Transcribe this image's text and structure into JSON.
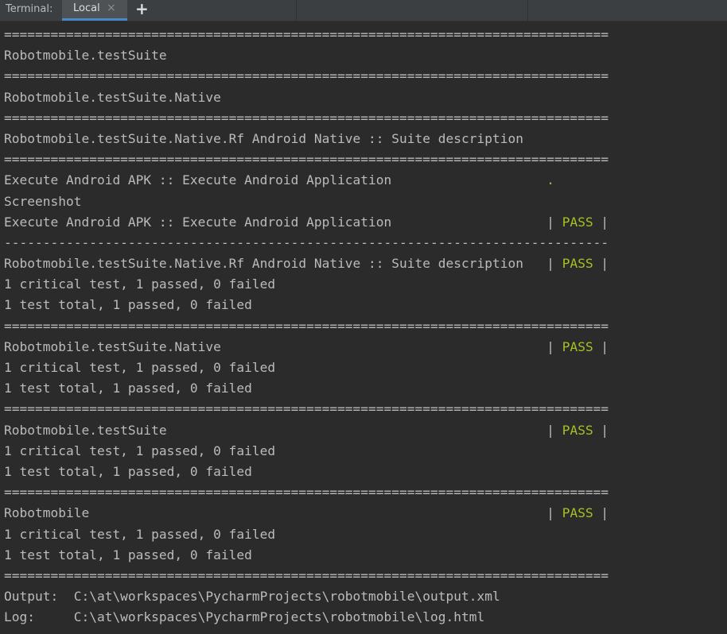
{
  "tabbar": {
    "title": "Terminal:",
    "active_tab": "Local",
    "close_glyph": "×",
    "add_glyph": "+"
  },
  "terminal": {
    "lines": [
      {
        "text": "==============================================================================",
        "pass": "",
        "suffix": ""
      },
      {
        "text": "Robotmobile.testSuite",
        "pass": "",
        "suffix": ""
      },
      {
        "text": "==============================================================================",
        "pass": "",
        "suffix": ""
      },
      {
        "text": "Robotmobile.testSuite.Native",
        "pass": "",
        "suffix": ""
      },
      {
        "text": "==============================================================================",
        "pass": "",
        "suffix": ""
      },
      {
        "text": "Robotmobile.testSuite.Native.Rf Android Native :: Suite description",
        "pass": "",
        "suffix": ""
      },
      {
        "text": "==============================================================================",
        "pass": "",
        "suffix": ""
      },
      {
        "text": "Execute Android APK :: Execute Android Application                    ",
        "pass": ".",
        "suffix": ""
      },
      {
        "text": "Screenshot",
        "pass": "",
        "suffix": ""
      },
      {
        "text": "Execute Android APK :: Execute Android Application                    | ",
        "pass": "PASS",
        "suffix": " |"
      },
      {
        "text": "------------------------------------------------------------------------------",
        "pass": "",
        "suffix": ""
      },
      {
        "text": "Robotmobile.testSuite.Native.Rf Android Native :: Suite description   | ",
        "pass": "PASS",
        "suffix": " |"
      },
      {
        "text": "1 critical test, 1 passed, 0 failed",
        "pass": "",
        "suffix": ""
      },
      {
        "text": "1 test total, 1 passed, 0 failed",
        "pass": "",
        "suffix": ""
      },
      {
        "text": "==============================================================================",
        "pass": "",
        "suffix": ""
      },
      {
        "text": "Robotmobile.testSuite.Native                                          | ",
        "pass": "PASS",
        "suffix": " |"
      },
      {
        "text": "1 critical test, 1 passed, 0 failed",
        "pass": "",
        "suffix": ""
      },
      {
        "text": "1 test total, 1 passed, 0 failed",
        "pass": "",
        "suffix": ""
      },
      {
        "text": "==============================================================================",
        "pass": "",
        "suffix": ""
      },
      {
        "text": "Robotmobile.testSuite                                                 | ",
        "pass": "PASS",
        "suffix": " |"
      },
      {
        "text": "1 critical test, 1 passed, 0 failed",
        "pass": "",
        "suffix": ""
      },
      {
        "text": "1 test total, 1 passed, 0 failed",
        "pass": "",
        "suffix": ""
      },
      {
        "text": "==============================================================================",
        "pass": "",
        "suffix": ""
      },
      {
        "text": "Robotmobile                                                           | ",
        "pass": "PASS",
        "suffix": " |"
      },
      {
        "text": "1 critical test, 1 passed, 0 failed",
        "pass": "",
        "suffix": ""
      },
      {
        "text": "1 test total, 1 passed, 0 failed",
        "pass": "",
        "suffix": ""
      },
      {
        "text": "==============================================================================",
        "pass": "",
        "suffix": ""
      },
      {
        "text": "Output:  C:\\at\\workspaces\\PycharmProjects\\robotmobile\\output.xml",
        "pass": "",
        "suffix": ""
      },
      {
        "text": "Log:     C:\\at\\workspaces\\PycharmProjects\\robotmobile\\log.html",
        "pass": "",
        "suffix": ""
      }
    ]
  },
  "colors": {
    "background": "#2b2b2b",
    "text": "#bbbbbb",
    "pass": "#a8c023",
    "tab_active_underline": "#4a88c7"
  }
}
